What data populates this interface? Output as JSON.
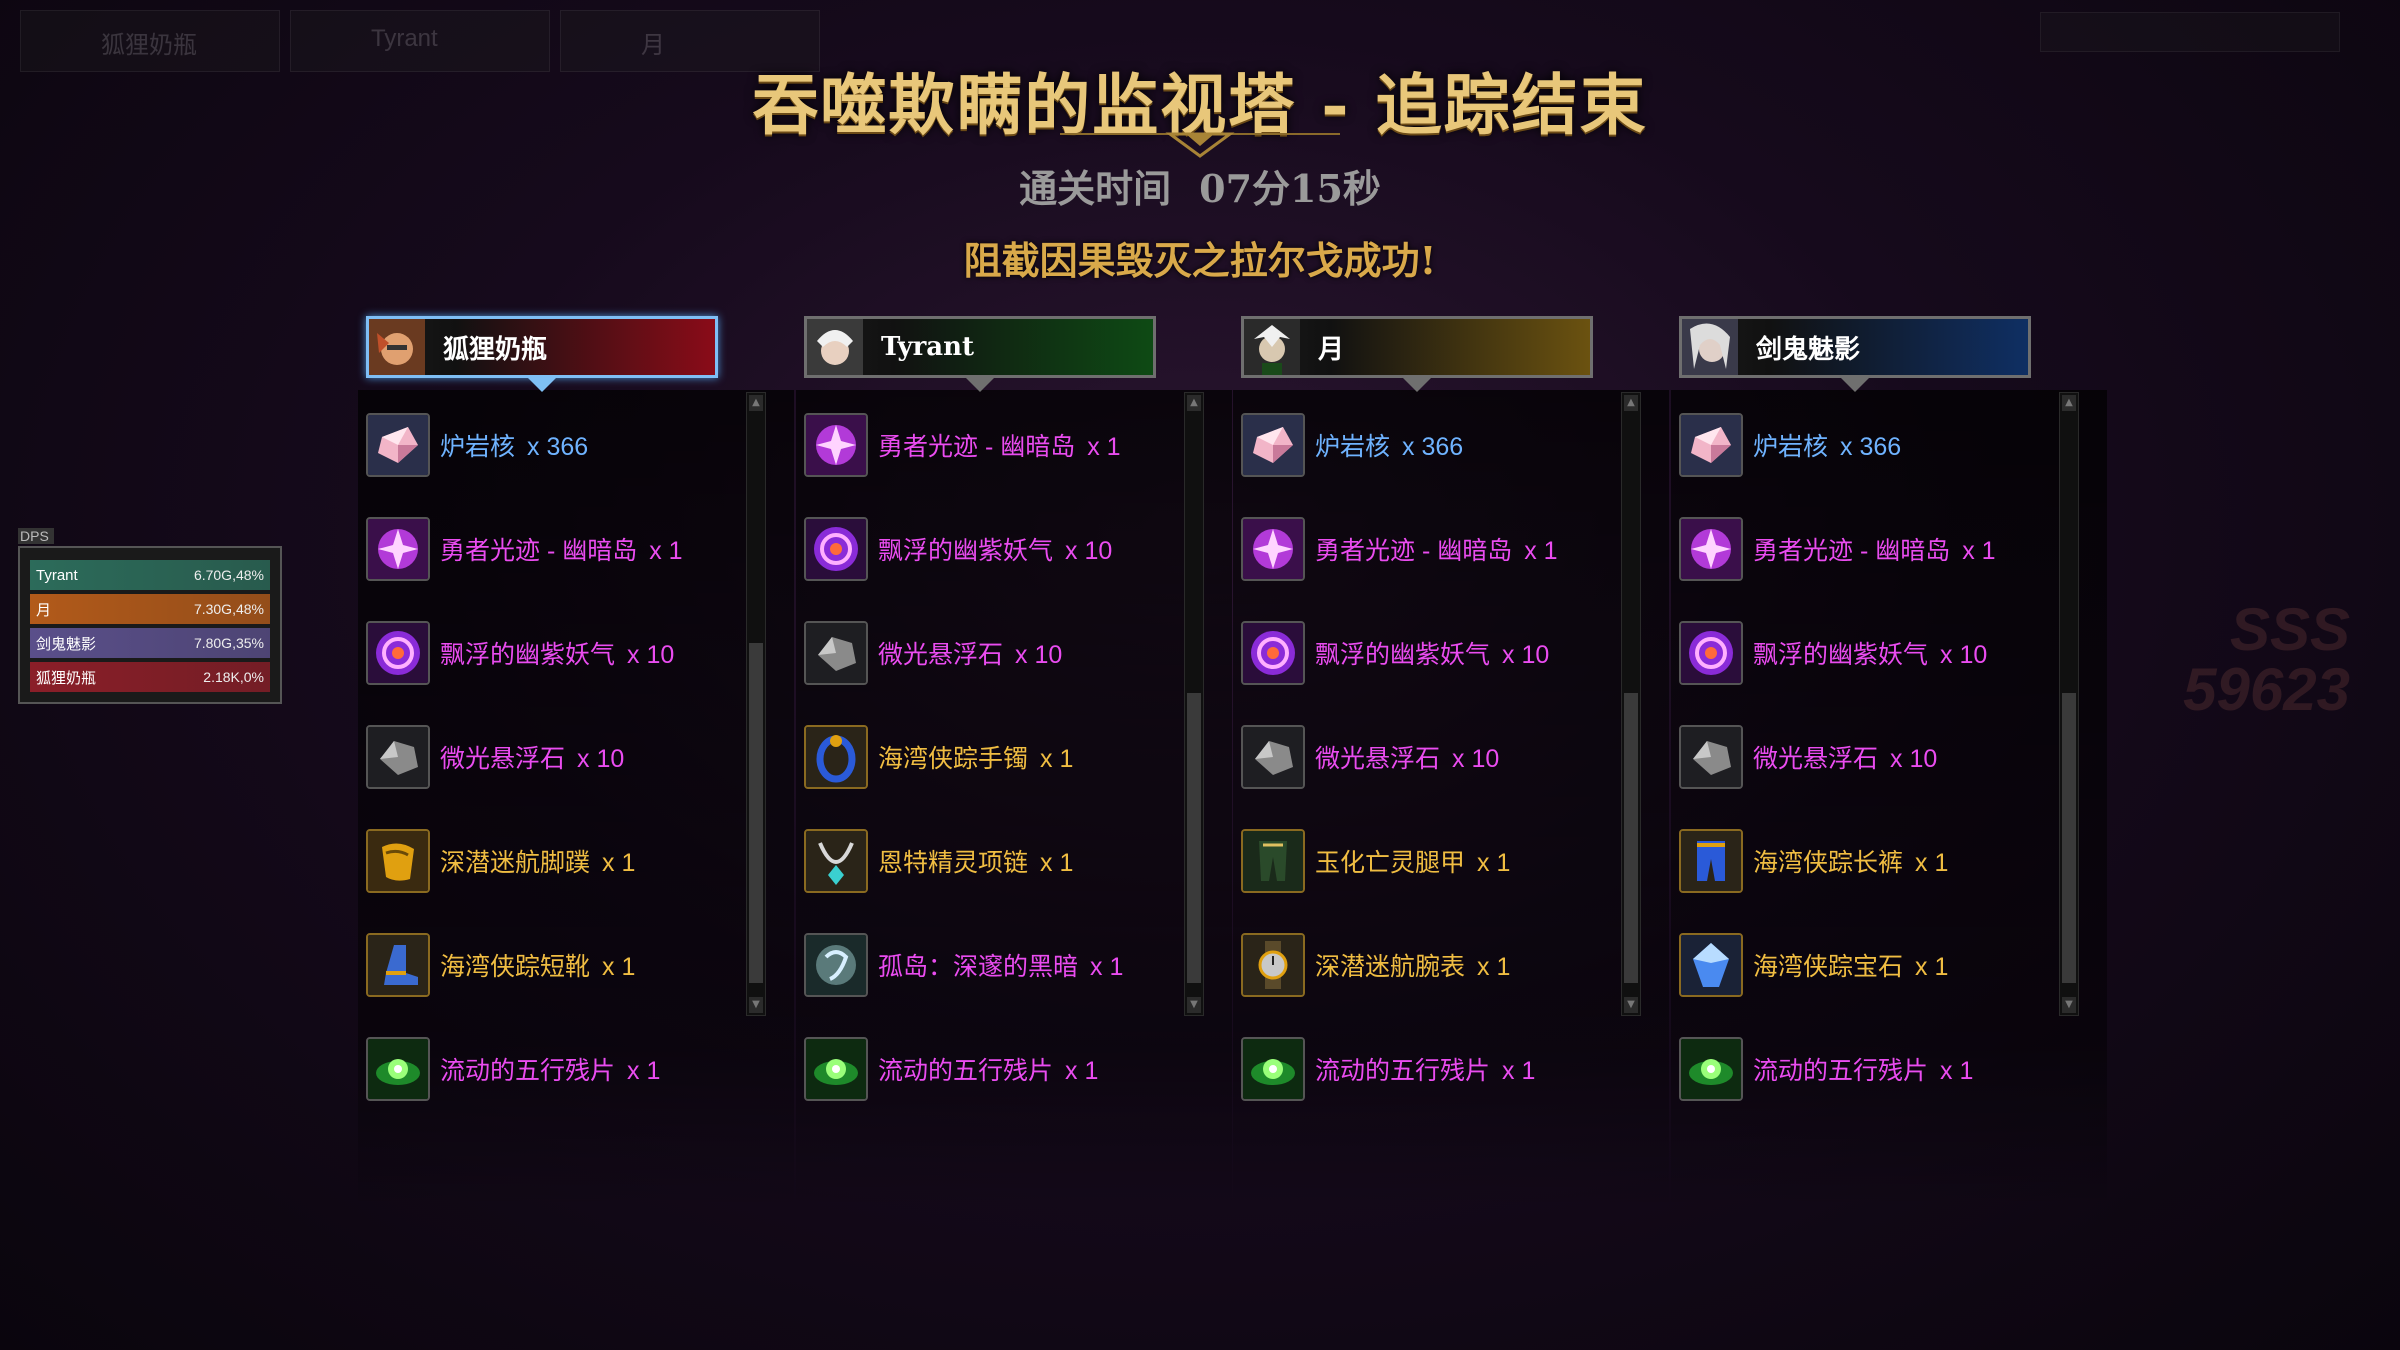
{
  "hud": {
    "slots": [
      "狐狸奶瓶",
      "Tyrant",
      "月"
    ],
    "score_top": "SSS",
    "score_num": "59623"
  },
  "header": {
    "title": "吞噬欺瞒的监视塔 - 追踪结束",
    "clear_time_label": "通关时间",
    "clear_time_value": "07分15秒",
    "success_text": "阻截因果毁灭之拉尔戈成功!"
  },
  "dps": {
    "tag": "DPS",
    "rows": [
      {
        "name": "Tyrant",
        "value": "6.70G,48%",
        "color": "#2c6b5a"
      },
      {
        "name": "月",
        "value": "7.30G,48%",
        "color": "#b25a1a"
      },
      {
        "name": "剑鬼魅影",
        "value": "7.80G,35%",
        "color": "#5a4f8a"
      },
      {
        "name": "狐狸奶瓶",
        "value": "2.18K,0%",
        "color": "#8a1e28"
      }
    ]
  },
  "colors": {
    "blue": "#6fb3ff",
    "pink": "#ea4cf0",
    "gold": "#f0bd42",
    "green": "#5ee86a",
    "title": "#e8c77a"
  },
  "players": [
    {
      "name": "狐狸奶瓶",
      "banner_color": "#8a0c18",
      "selected": true,
      "avatar": "fox-avatar",
      "items": [
        {
          "name": "炉岩核",
          "qty": "x 366",
          "rarity": "blue",
          "icon": "crystal-icon"
        },
        {
          "name": "勇者光迹 - 幽暗岛",
          "qty": "x 1",
          "rarity": "pink",
          "icon": "light-trace-icon"
        },
        {
          "name": "飘浮的幽紫妖气",
          "qty": "x 10",
          "rarity": "pink",
          "icon": "purple-aura-icon"
        },
        {
          "name": "微光悬浮石",
          "qty": "x 10",
          "rarity": "pink",
          "icon": "floating-stone-icon"
        },
        {
          "name": "深潜迷航脚蹼",
          "qty": "x 1",
          "rarity": "gold",
          "icon": "flippers-icon"
        },
        {
          "name": "海湾侠踪短靴",
          "qty": "x 1",
          "rarity": "gold",
          "icon": "boots-icon"
        },
        {
          "name": "流动的五行残片",
          "qty": "x 1",
          "rarity": "pink",
          "icon": "green-shard-icon"
        }
      ]
    },
    {
      "name": "Tyrant",
      "banner_color": "#0e4a14",
      "selected": false,
      "avatar": "white-hair-avatar",
      "items": [
        {
          "name": "勇者光迹 - 幽暗岛",
          "qty": "x 1",
          "rarity": "pink",
          "icon": "light-trace-icon"
        },
        {
          "name": "飘浮的幽紫妖气",
          "qty": "x 10",
          "rarity": "pink",
          "icon": "purple-aura-icon"
        },
        {
          "name": "微光悬浮石",
          "qty": "x 10",
          "rarity": "pink",
          "icon": "floating-stone-icon"
        },
        {
          "name": "海湾侠踪手镯",
          "qty": "x 1",
          "rarity": "gold",
          "icon": "bracelet-icon"
        },
        {
          "name": "恩特精灵项链",
          "qty": "x 1",
          "rarity": "gold",
          "icon": "necklace-icon"
        },
        {
          "name": "孤岛：深邃的黑暗",
          "qty": "x 1",
          "rarity": "pink",
          "icon": "dark-orb-icon"
        },
        {
          "name": "流动的五行残片",
          "qty": "x 1",
          "rarity": "pink",
          "icon": "green-shard-icon"
        }
      ]
    },
    {
      "name": "月",
      "banner_color": "#6b5210",
      "selected": false,
      "avatar": "moon-avatar",
      "items": [
        {
          "name": "炉岩核",
          "qty": "x 366",
          "rarity": "blue",
          "icon": "crystal-icon"
        },
        {
          "name": "勇者光迹 - 幽暗岛",
          "qty": "x 1",
          "rarity": "pink",
          "icon": "light-trace-icon"
        },
        {
          "name": "飘浮的幽紫妖气",
          "qty": "x 10",
          "rarity": "pink",
          "icon": "purple-aura-icon"
        },
        {
          "name": "微光悬浮石",
          "qty": "x 10",
          "rarity": "pink",
          "icon": "floating-stone-icon"
        },
        {
          "name": "玉化亡灵腿甲",
          "qty": "x 1",
          "rarity": "gold",
          "icon": "leg-armor-icon"
        },
        {
          "name": "深潜迷航腕表",
          "qty": "x 1",
          "rarity": "gold",
          "icon": "wristwatch-icon"
        },
        {
          "name": "流动的五行残片",
          "qty": "x 1",
          "rarity": "pink",
          "icon": "green-shard-icon"
        }
      ]
    },
    {
      "name": "剑鬼魅影",
      "banner_color": "#0f2f63",
      "selected": false,
      "avatar": "swordsman-avatar",
      "items": [
        {
          "name": "炉岩核",
          "qty": "x 366",
          "rarity": "blue",
          "icon": "crystal-icon"
        },
        {
          "name": "勇者光迹 - 幽暗岛",
          "qty": "x 1",
          "rarity": "pink",
          "icon": "light-trace-icon"
        },
        {
          "name": "飘浮的幽紫妖气",
          "qty": "x 10",
          "rarity": "pink",
          "icon": "purple-aura-icon"
        },
        {
          "name": "微光悬浮石",
          "qty": "x 10",
          "rarity": "pink",
          "icon": "floating-stone-icon"
        },
        {
          "name": "海湾侠踪长裤",
          "qty": "x 1",
          "rarity": "gold",
          "icon": "pants-icon"
        },
        {
          "name": "海湾侠踪宝石",
          "qty": "x 1",
          "rarity": "gold",
          "icon": "gem-icon"
        },
        {
          "name": "流动的五行残片",
          "qty": "x 1",
          "rarity": "pink",
          "icon": "green-shard-icon"
        }
      ]
    }
  ]
}
